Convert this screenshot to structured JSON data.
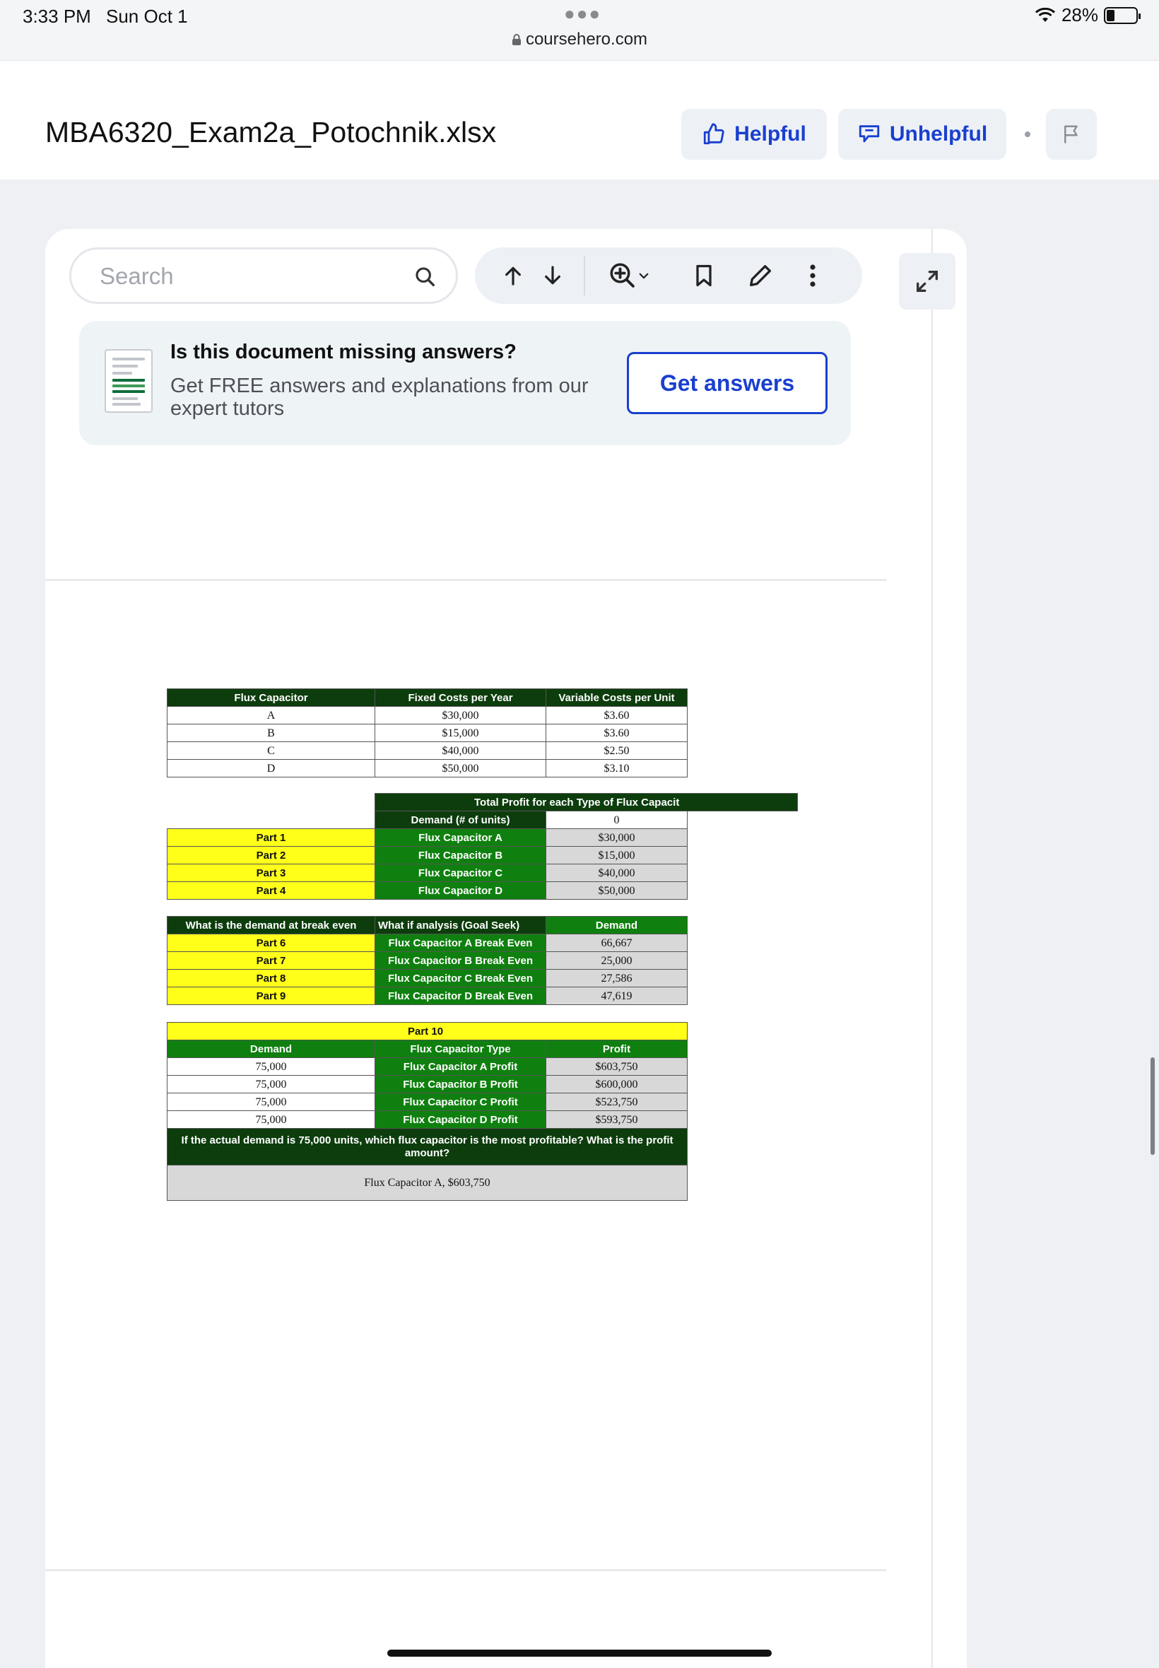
{
  "status_bar": {
    "time": "3:33 PM",
    "date": "Sun Oct 1",
    "url": "coursehero.com",
    "battery": "28%"
  },
  "header": {
    "title": "MBA6320_Exam2a_Potochnik.xlsx",
    "helpful_label": "Helpful",
    "unhelpful_label": "Unhelpful"
  },
  "toolbar": {
    "search_placeholder": "Search"
  },
  "banner": {
    "heading": "Is this document missing answers?",
    "text": "Get FREE answers and explanations from our expert tutors",
    "button": "Get answers"
  },
  "sheet": {
    "table1": {
      "headers": [
        "Flux Capacitor",
        "Fixed Costs per Year",
        "Variable Costs per Unit"
      ],
      "rows": [
        [
          "A",
          "$30,000",
          "$3.60"
        ],
        [
          "B",
          "$15,000",
          "$3.60"
        ],
        [
          "C",
          "$40,000",
          "$2.50"
        ],
        [
          "D",
          "$50,000",
          "$3.10"
        ]
      ]
    },
    "table2": {
      "title": "Total Profit for each Type of Flux Capacit",
      "demand_label": "Demand (# of units)",
      "demand_value": "0",
      "rows": [
        [
          "Part 1",
          "Flux Capacitor A",
          "$30,000"
        ],
        [
          "Part 2",
          "Flux Capacitor B",
          "$15,000"
        ],
        [
          "Part 3",
          "Flux Capacitor C",
          "$40,000"
        ],
        [
          "Part 4",
          "Flux Capacitor D",
          "$50,000"
        ]
      ]
    },
    "table3": {
      "headers": [
        "What is the demand at break even",
        "What if analysis (Goal Seek)",
        "Demand"
      ],
      "rows": [
        [
          "Part 6",
          "Flux Capacitor A Break Even",
          "66,667"
        ],
        [
          "Part 7",
          "Flux Capacitor B Break Even",
          "25,000"
        ],
        [
          "Part 8",
          "Flux Capacitor C Break Even",
          "27,586"
        ],
        [
          "Part 9",
          "Flux Capacitor D Break Even",
          "47,619"
        ]
      ]
    },
    "table4": {
      "part_label": "Part 10",
      "headers": [
        "Demand",
        "Flux Capacitor Type",
        "Profit"
      ],
      "rows": [
        [
          "75,000",
          "Flux Capacitor A Profit",
          "$603,750"
        ],
        [
          "75,000",
          "Flux Capacitor B Profit",
          "$600,000"
        ],
        [
          "75,000",
          "Flux Capacitor C Profit",
          "$523,750"
        ],
        [
          "75,000",
          "Flux Capacitor D Profit",
          "$593,750"
        ]
      ],
      "question": "If the actual demand is 75,000 units, which flux capacitor is the most profitable? What is the profit amount?",
      "answer": "Flux Capacitor A, $603,750"
    }
  }
}
